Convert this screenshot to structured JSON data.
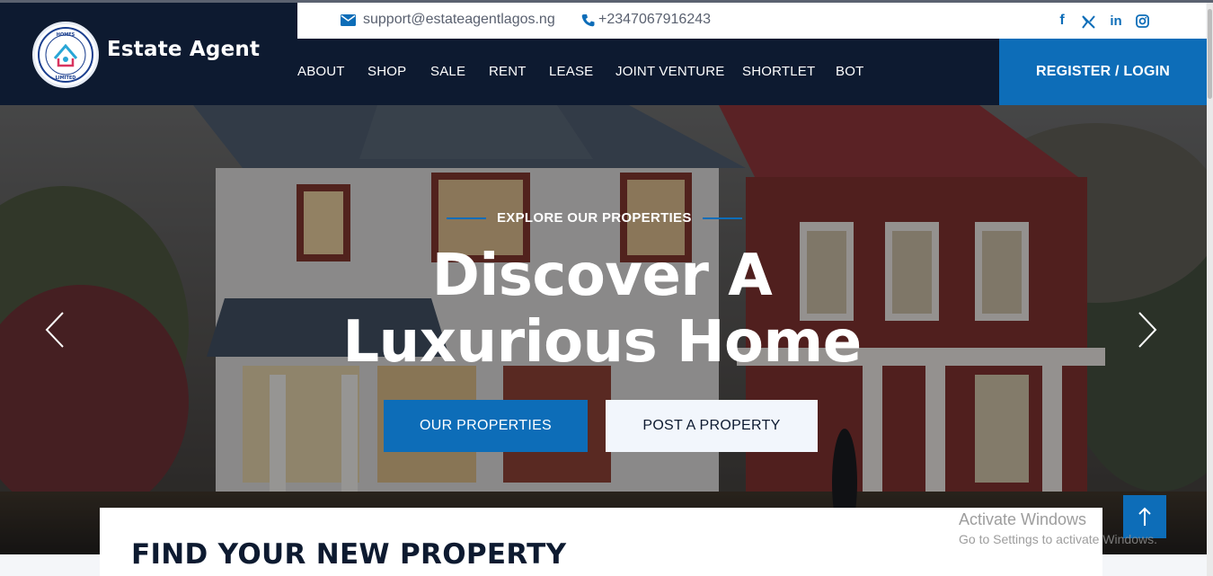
{
  "brand": {
    "name": "Estate Agent",
    "logo_icon": "house-circle-logo",
    "logo_text": "NNENDU HOMES & PROPERTIES LIMITED"
  },
  "contact": {
    "email": "support@estateagentlagos.ng",
    "phone": "+2347067916243",
    "social": [
      {
        "name": "facebook-icon",
        "glyph": "f"
      },
      {
        "name": "x-twitter-icon",
        "glyph": "𝕏"
      },
      {
        "name": "linkedin-icon",
        "glyph": "in"
      },
      {
        "name": "instagram-icon",
        "glyph": "◎"
      }
    ]
  },
  "nav": {
    "items": [
      "ABOUT",
      "SHOP",
      "SALE",
      "RENT",
      "LEASE",
      "JOINT VENTURE",
      "SHORTLET",
      "BOT"
    ],
    "register_label": "REGISTER / LOGIN"
  },
  "hero": {
    "eyebrow": "EXPLORE OUR PROPERTIES",
    "headline_line1": "Discover A",
    "headline_line2": "Luxurious Home",
    "primary_button": "OUR PROPERTIES",
    "secondary_button": "POST A PROPERTY"
  },
  "search": {
    "title": "FIND YOUR NEW PROPERTY"
  },
  "watermark": {
    "line1": "Activate Windows",
    "line2": "Go to Settings to activate Windows."
  },
  "colors": {
    "navy": "#0d1a30",
    "accent": "#0d6db8",
    "light_button": "#f2f6fc"
  }
}
